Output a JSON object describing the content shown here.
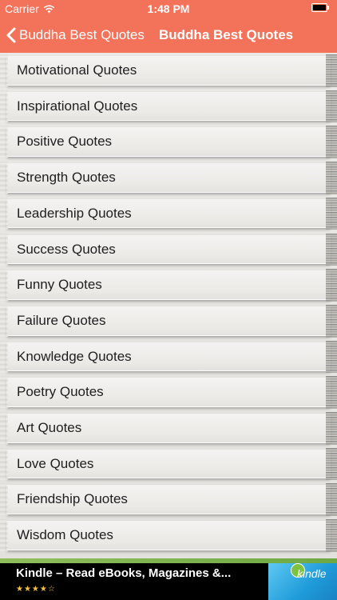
{
  "status_bar": {
    "carrier": "Carrier",
    "time": "1:48 PM"
  },
  "nav": {
    "back_label": "Buddha Best Quotes",
    "title": "Buddha Best Quotes"
  },
  "list": {
    "items": [
      "Motivational Quotes",
      "Inspirational Quotes",
      "Positive Quotes",
      "Strength Quotes",
      "Leadership Quotes",
      "Success Quotes",
      "Funny Quotes",
      "Failure Quotes",
      "Knowledge Quotes",
      "Poetry Quotes",
      "Art Quotes",
      "Love Quotes",
      "Friendship Quotes",
      "Wisdom Quotes"
    ]
  },
  "ad": {
    "title": "Kindle – Read eBooks, Magazines &...",
    "rating_stars": "★★★★☆",
    "rating_value": 3.5,
    "kindle_text": "kindle"
  },
  "colors": {
    "nav_background": "#f2725a",
    "text": "#1e1e1e",
    "ad_background": "#000000",
    "star": "#f5c33b"
  }
}
